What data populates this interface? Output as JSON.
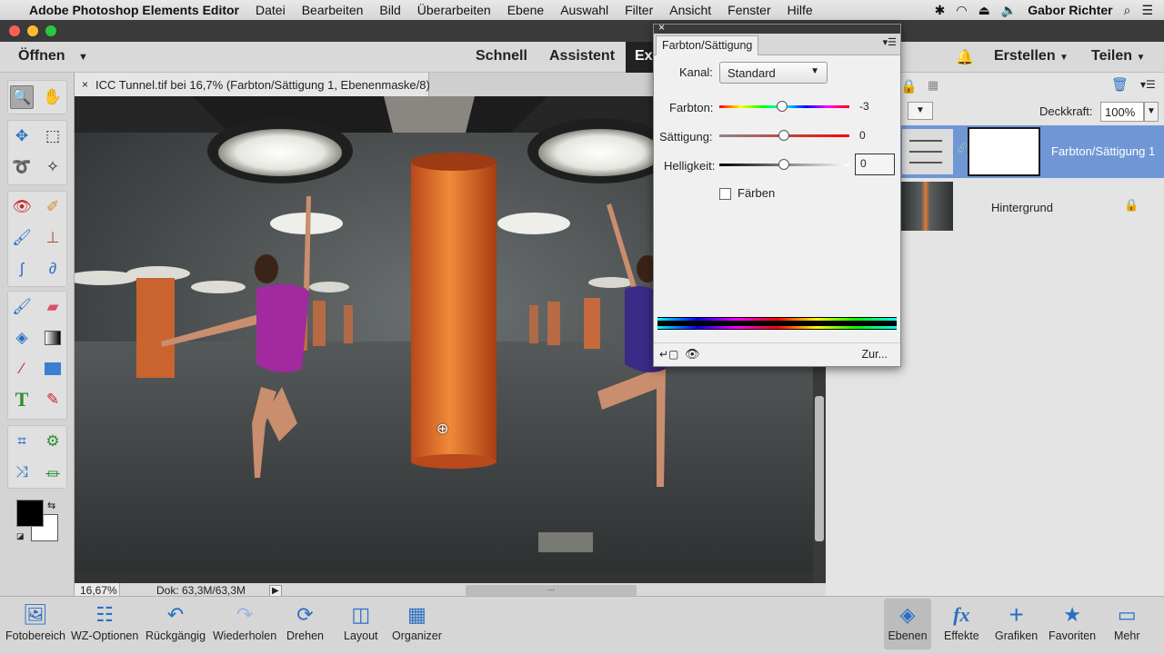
{
  "menubar": {
    "app": "Adobe Photoshop Elements Editor",
    "items": [
      "Datei",
      "Bearbeiten",
      "Bild",
      "Überarbeiten",
      "Ebene",
      "Auswahl",
      "Filter",
      "Ansicht",
      "Fenster",
      "Hilfe"
    ],
    "user": "Gabor Richter"
  },
  "modebar": {
    "open": "Öffnen",
    "quick": "Schnell",
    "assistant": "Assistent",
    "expert": "Ex",
    "create": "Erstellen",
    "share": "Teilen"
  },
  "document": {
    "tab_title": "ICC Tunnel.tif bei 16,7% (Farbton/Sättigung 1, Ebenenmaske/8) *",
    "zoom": "16,67%",
    "doc_size": "Dok: 63,3M/63,3M"
  },
  "dialog": {
    "tab": "Farbton/Sättigung",
    "channel_label": "Kanal:",
    "channel_value": "Standard",
    "hue_label": "Farbton:",
    "hue_value": "-3",
    "sat_label": "Sättigung:",
    "sat_value": "0",
    "light_label": "Helligkeit:",
    "light_value": "0",
    "colorize_label": "Färben",
    "reset_label": "Zur..."
  },
  "layers": {
    "opacity_label": "Deckkraft:",
    "opacity_value": "100%",
    "items": [
      {
        "name": "Farbton/Sättigung 1",
        "selected": true
      },
      {
        "name": "Hintergrund",
        "selected": false
      }
    ]
  },
  "bottombar": {
    "left": [
      "Fotobereich",
      "WZ-Optionen",
      "Rückgängig",
      "Wiederholen",
      "Drehen",
      "Layout",
      "Organizer"
    ],
    "right": [
      "Ebenen",
      "Effekte",
      "Grafiken",
      "Favoriten",
      "Mehr"
    ]
  },
  "colors": {
    "accent": "#5b8dd6",
    "foreground": "#000000",
    "background": "#ffffff"
  }
}
